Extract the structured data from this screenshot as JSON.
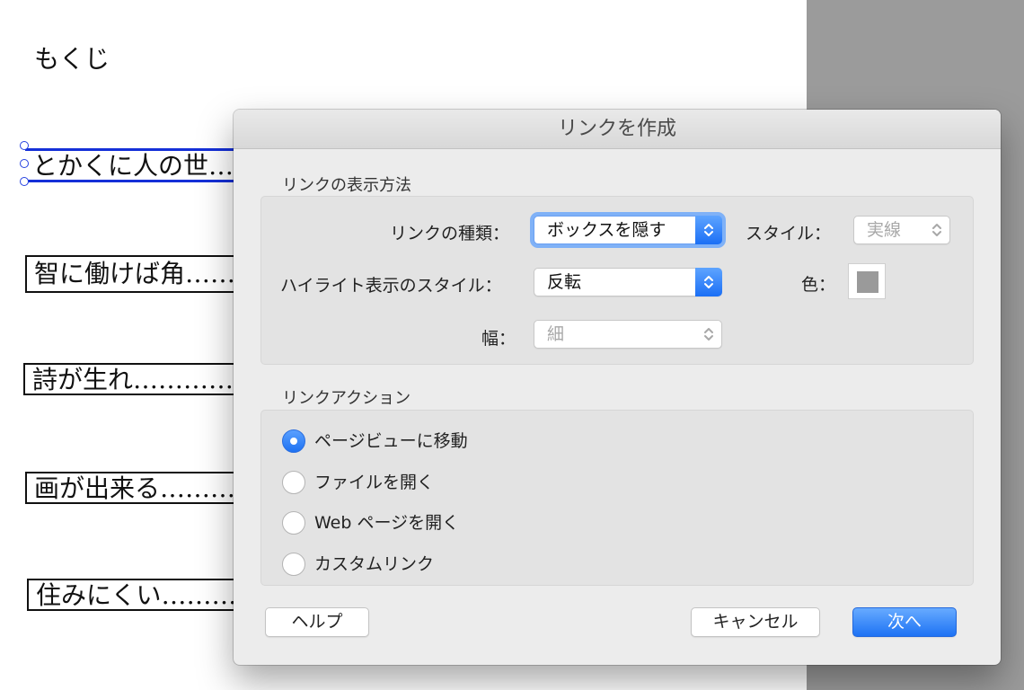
{
  "document": {
    "title": "もくじ",
    "entries": [
      "とかくに人の世…………",
      "智に働けば角……………",
      "詩が生れ…………………",
      "画が出来る………………",
      "住みにくい………………"
    ]
  },
  "dialog": {
    "title": "リンクを作成",
    "appearance": {
      "section_label": "リンクの表示方法",
      "link_type_label": "リンクの種類：",
      "link_type_value": "ボックスを隠す",
      "style_label": "スタイル：",
      "style_value": "実線",
      "highlight_label": "ハイライト表示のスタイル：",
      "highlight_value": "反転",
      "color_label": "色：",
      "width_label": "幅：",
      "width_value": "細",
      "color_value": "#9a9a9a"
    },
    "action": {
      "section_label": "リンクアクション",
      "options": [
        {
          "label": "ページビューに移動",
          "checked": true
        },
        {
          "label": "ファイルを開く",
          "checked": false
        },
        {
          "label": "Web ページを開く",
          "checked": false
        },
        {
          "label": "カスタムリンク",
          "checked": false
        }
      ]
    },
    "buttons": {
      "help": "ヘルプ",
      "cancel": "キャンセル",
      "next": "次へ"
    }
  },
  "colors": {
    "accent": "#1d72f4",
    "selection": "#1530d8"
  }
}
